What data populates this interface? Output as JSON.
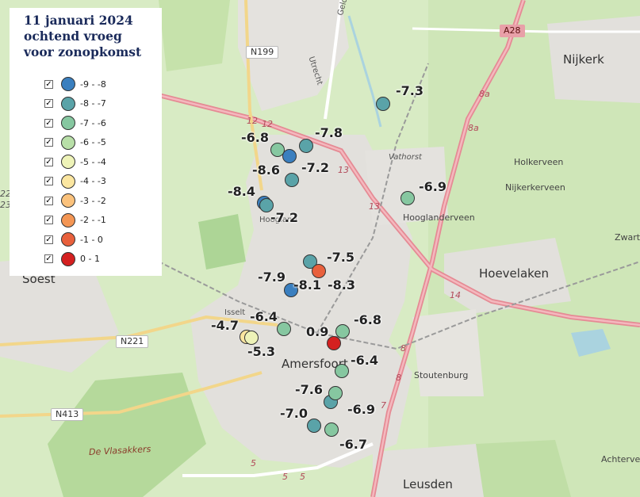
{
  "legend": {
    "title_lines": [
      "11 januari 2024",
      "ochtend vroeg",
      "voor zonopkomst"
    ],
    "items": [
      {
        "label": "-9 - -8",
        "color": "#3a7fbf",
        "checked": "✓"
      },
      {
        "label": "-8 - -7",
        "color": "#5aa3a8",
        "checked": "✓"
      },
      {
        "label": "-7 - -6",
        "color": "#86c7a0",
        "checked": "✓"
      },
      {
        "label": "-6 - -5",
        "color": "#b8dfa8",
        "checked": "✓"
      },
      {
        "label": "-5 - -4",
        "color": "#eef3b8",
        "checked": "✓"
      },
      {
        "label": "-4 - -3",
        "color": "#fbe6a0",
        "checked": "✓"
      },
      {
        "label": "-3 - -2",
        "color": "#fbc27c",
        "checked": "✓"
      },
      {
        "label": "-2 - -1",
        "color": "#f49654",
        "checked": "✓"
      },
      {
        "label": "-1 - 0",
        "color": "#e8603c",
        "checked": "✓"
      },
      {
        "label": "0 - 1",
        "color": "#d42020",
        "checked": "✓"
      }
    ]
  },
  "places": [
    {
      "name": "Nijkerk",
      "cls": "big"
    },
    {
      "name": "Hoevelaken",
      "cls": "big"
    },
    {
      "name": "Amersfoort",
      "cls": "big"
    },
    {
      "name": "Leusden",
      "cls": "big"
    },
    {
      "name": "Soest",
      "cls": "big"
    },
    {
      "name": "Hooglanderveen",
      "cls": "mid"
    },
    {
      "name": "Holkerveen",
      "cls": "mid"
    },
    {
      "name": "Nijkerkerveen",
      "cls": "mid"
    },
    {
      "name": "Stoutenburg",
      "cls": "mid"
    },
    {
      "name": "Achterve",
      "cls": "mid"
    },
    {
      "name": "Zwart",
      "cls": "mid"
    },
    {
      "name": "Vathorst",
      "cls": "small"
    },
    {
      "name": "Hoogland",
      "cls": "small"
    },
    {
      "name": "Isselt",
      "cls": "small"
    },
    {
      "name": "Gelderland",
      "cls": "small"
    },
    {
      "name": "Utrecht",
      "cls": "small"
    },
    {
      "name": "De Vlasakkers",
      "cls": "italic"
    }
  ],
  "shields": [
    {
      "text": "A28",
      "cls": "a"
    },
    {
      "text": "N199",
      "cls": "n"
    },
    {
      "text": "N221",
      "cls": "n"
    },
    {
      "text": "N413",
      "cls": "n"
    }
  ],
  "road_numbers": [
    "12",
    "12",
    "13",
    "13",
    "8a",
    "8a",
    "14",
    "8",
    "8",
    "7",
    "5",
    "5",
    "5",
    "22",
    "23"
  ],
  "measurements": [
    {
      "value": "-7.3",
      "class": 1
    },
    {
      "value": "-7.8",
      "class": 1
    },
    {
      "value": "-6.8",
      "class": 2
    },
    {
      "value": "-8.6",
      "class": 0
    },
    {
      "value": "-7.2",
      "class": 1
    },
    {
      "value": "-6.9",
      "class": 2
    },
    {
      "value": "-8.4",
      "class": 0
    },
    {
      "value": "-7.2",
      "class": 1
    },
    {
      "value": "-7.5",
      "class": 1
    },
    {
      "value": "-7.9",
      "class": 1
    },
    {
      "value": "-8.1",
      "class": 0
    },
    {
      "value": "-8.3",
      "class": 8
    },
    {
      "value": "-6.4",
      "class": 2
    },
    {
      "value": "-4.7",
      "class": 5
    },
    {
      "value": "-5.3",
      "class": 4
    },
    {
      "value": "0.9",
      "class": 9
    },
    {
      "value": "-6.8",
      "class": 2
    },
    {
      "value": "-6.4",
      "class": 2
    },
    {
      "value": "-7.6",
      "class": 1
    },
    {
      "value": "-6.9",
      "class": 2
    },
    {
      "value": "-7.0",
      "class": 1
    },
    {
      "value": "-6.7",
      "class": 2
    }
  ]
}
